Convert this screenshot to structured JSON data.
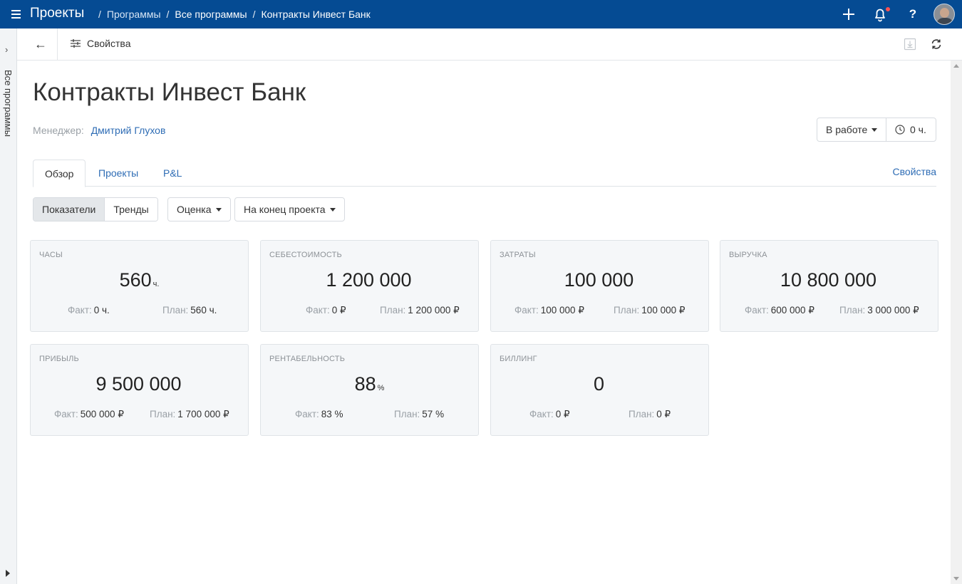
{
  "header": {
    "app_title": "Проекты",
    "breadcrumb": [
      {
        "label": "Программы"
      },
      {
        "label": "Все программы"
      },
      {
        "label": "Контракты Инвест Банк"
      }
    ],
    "separator": "/",
    "help_label": "?",
    "brand_color": "#054b93"
  },
  "left_rail": {
    "chevron": "›",
    "label": "Все программы"
  },
  "toolbar": {
    "back_glyph": "←",
    "properties_label": "Свойства"
  },
  "page": {
    "title": "Контракты Инвест Банк",
    "manager_label": "Менеджер:",
    "manager_name": "Дмитрий Глухов",
    "status_value": "В работе",
    "time_value": "0 ч."
  },
  "tabs": {
    "items": [
      {
        "label": "Обзор",
        "active": true
      },
      {
        "label": "Проекты",
        "active": false
      },
      {
        "label": "P&L",
        "active": false
      }
    ],
    "right_link": "Свойства"
  },
  "filters": {
    "segment": [
      {
        "label": "Показатели",
        "active": true
      },
      {
        "label": "Тренды",
        "active": false
      }
    ],
    "dropdown_estimate": "Оценка",
    "dropdown_period": "На конец проекта"
  },
  "cards": [
    {
      "label": "ЧАСЫ",
      "value": "560",
      "unit": "ч.",
      "fact_label": "Факт:",
      "fact": "0 ч.",
      "plan_label": "План:",
      "plan": "560 ч."
    },
    {
      "label": "СЕБЕСТОИМОСТЬ",
      "value": "1 200 000",
      "unit": "",
      "fact_label": "Факт:",
      "fact": "0 ₽",
      "plan_label": "План:",
      "plan": "1 200 000 ₽"
    },
    {
      "label": "ЗАТРАТЫ",
      "value": "100 000",
      "unit": "",
      "fact_label": "Факт:",
      "fact": "100 000 ₽",
      "plan_label": "План:",
      "plan": "100 000 ₽"
    },
    {
      "label": "ВЫРУЧКА",
      "value": "10 800 000",
      "unit": "",
      "fact_label": "Факт:",
      "fact": "600 000 ₽",
      "plan_label": "План:",
      "plan": "3 000 000 ₽"
    },
    {
      "label": "ПРИБЫЛЬ",
      "value": "9 500 000",
      "unit": "",
      "fact_label": "Факт:",
      "fact": "500 000 ₽",
      "plan_label": "План:",
      "plan": "1 700 000 ₽"
    },
    {
      "label": "РЕНТАБЕЛЬНОСТЬ",
      "value": "88",
      "unit": "%",
      "fact_label": "Факт:",
      "fact": "83 %",
      "plan_label": "План:",
      "plan": "57 %"
    },
    {
      "label": "БИЛЛИНГ",
      "value": "0",
      "unit": "",
      "fact_label": "Факт:",
      "fact": "0 ₽",
      "plan_label": "План:",
      "plan": "0 ₽"
    }
  ]
}
